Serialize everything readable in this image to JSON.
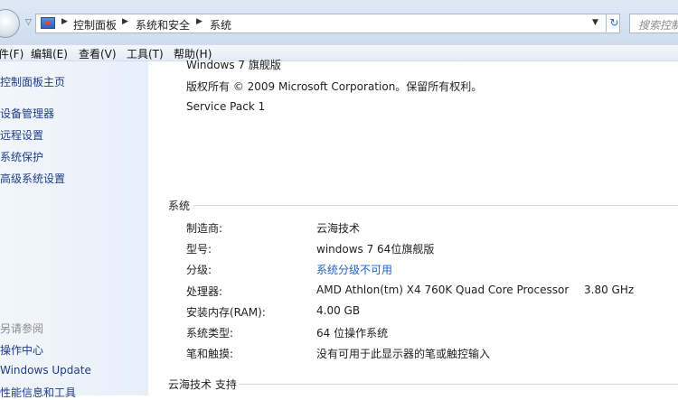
{
  "address": {
    "breadcrumbs": [
      "控制面板",
      "系统和安全",
      "系统"
    ],
    "search_placeholder": "搜索控制"
  },
  "menu": [
    "件(F)",
    "编辑(E)",
    "查看(V)",
    "工具(T)",
    "帮助(H)"
  ],
  "sidebar": {
    "links": [
      "控制面板主页",
      "设备管理器",
      "远程设置",
      "系统保护",
      "高级系统设置"
    ],
    "see_also_header": "另请参阅",
    "see_also": [
      "操作中心",
      "Windows Update",
      "性能信息和工具"
    ]
  },
  "edition": {
    "name_partial": "Windows 7 旗舰版",
    "copyright": "版权所有 © 2009 Microsoft Corporation。保留所有权利。",
    "service_pack": "Service Pack 1"
  },
  "system": {
    "header": "系统",
    "rows": [
      {
        "label": "制造商:",
        "value": "云海技术"
      },
      {
        "label": "型号:",
        "value": "windows 7 64位旗舰版"
      },
      {
        "label": "分级:",
        "value": "系统分级不可用"
      },
      {
        "label": "处理器:",
        "value": "AMD Athlon(tm) X4 760K Quad Core Processor",
        "extra": "3.80 GHz"
      },
      {
        "label": "安装内存(RAM):",
        "value": "4.00 GB"
      },
      {
        "label": "系统类型:",
        "value": "64 位操作系统"
      },
      {
        "label": "笔和触摸:",
        "value": "没有可用于此显示器的笔或触控输入"
      }
    ]
  },
  "support": {
    "header": "云海技术 支持"
  }
}
